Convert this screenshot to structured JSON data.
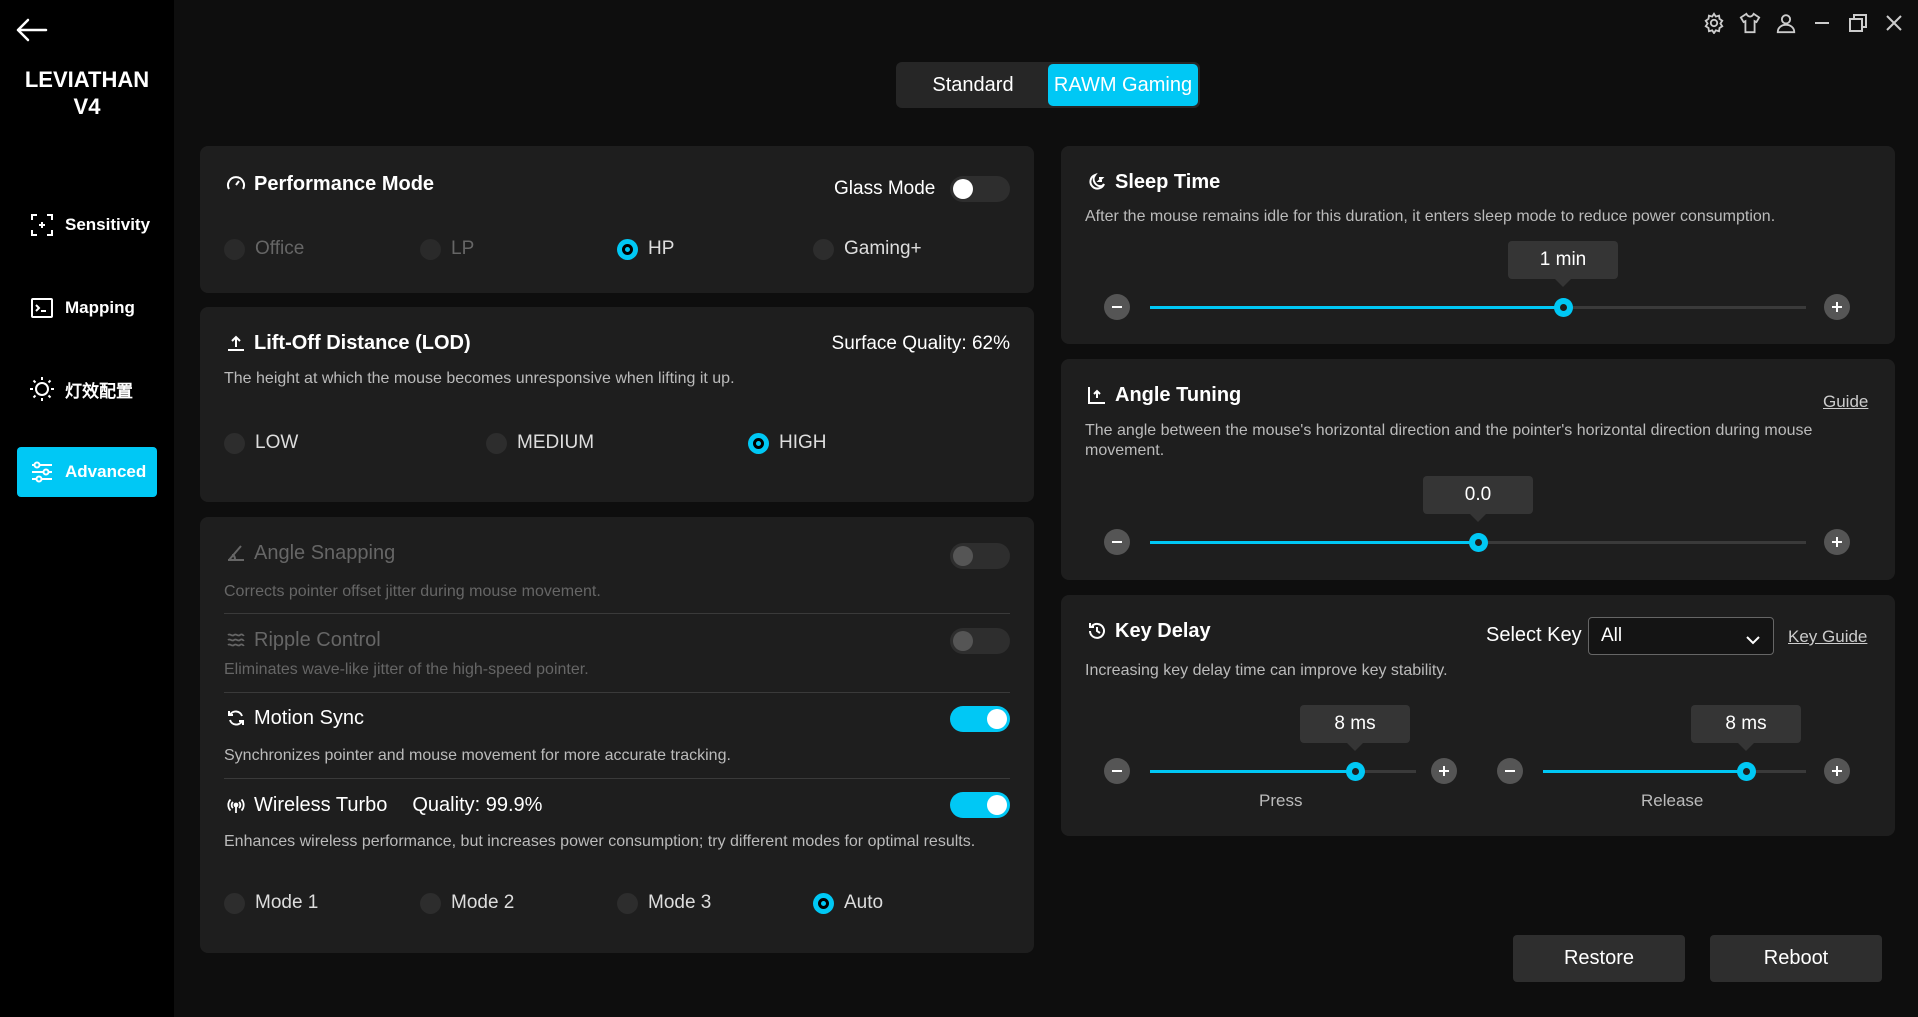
{
  "app": {
    "brand_line1": "LEVIATHAN",
    "brand_line2": "V4"
  },
  "nav": [
    {
      "label": "Sensitivity",
      "icon": "sensitivity-icon"
    },
    {
      "label": "Mapping",
      "icon": "mapping-icon"
    },
    {
      "label": "灯效配置",
      "icon": "lighting-icon"
    },
    {
      "label": "Advanced",
      "icon": "advanced-icon",
      "active": true
    }
  ],
  "mode_tabs": {
    "standard": "Standard",
    "rawm": "RAWM Gaming",
    "active": "RAWM Gaming"
  },
  "performance": {
    "title": "Performance Mode",
    "glass_mode_label": "Glass Mode",
    "glass_mode_on": false,
    "options": [
      "Office",
      "LP",
      "HP",
      "Gaming+"
    ],
    "selected": "HP"
  },
  "lod": {
    "title": "Lift-Off Distance (LOD)",
    "surface_quality": "Surface Quality: 62%",
    "description": "The height at which the mouse becomes unresponsive when lifting it up.",
    "options": [
      "LOW",
      "MEDIUM",
      "HIGH"
    ],
    "selected": "HIGH"
  },
  "angle_snapping": {
    "title": "Angle Snapping",
    "description": "Corrects pointer offset jitter during mouse movement.",
    "enabled": false,
    "disabled": true
  },
  "ripple_control": {
    "title": "Ripple Control",
    "description": "Eliminates wave-like jitter of the high-speed pointer.",
    "enabled": false,
    "disabled": true
  },
  "motion_sync": {
    "title": "Motion Sync",
    "description": "Synchronizes pointer and mouse movement for more accurate tracking.",
    "enabled": true
  },
  "wireless_turbo": {
    "title": "Wireless Turbo",
    "quality": "Quality: 99.9%",
    "description": "Enhances wireless performance, but increases power consumption; try different modes for optimal results.",
    "enabled": true,
    "options": [
      "Mode 1",
      "Mode 2",
      "Mode 3",
      "Auto"
    ],
    "selected": "Auto"
  },
  "sleep_time": {
    "title": "Sleep Time",
    "description": "After the mouse remains idle for this duration, it enters sleep mode to reduce power consumption.",
    "value_label": "1 min",
    "fraction": 0.63
  },
  "angle_tuning": {
    "title": "Angle Tuning",
    "guide": "Guide",
    "description": "The angle between the mouse's horizontal direction and the pointer's horizontal direction during mouse movement.",
    "value_label": "0.0",
    "fraction": 0.5
  },
  "key_delay": {
    "title": "Key Delay",
    "select_key_label": "Select Key",
    "select_value": "All",
    "key_guide": "Key Guide",
    "description": "Increasing key delay time can improve key stability.",
    "press": {
      "label": "Press",
      "value_label": "8 ms",
      "fraction": 0.77
    },
    "release": {
      "label": "Release",
      "value_label": "8 ms",
      "fraction": 0.77
    }
  },
  "actions": {
    "restore": "Restore",
    "reboot": "Reboot"
  },
  "colors": {
    "accent": "#00c8f5",
    "card": "#1e1e1e",
    "bg": "#0e0e0e"
  }
}
